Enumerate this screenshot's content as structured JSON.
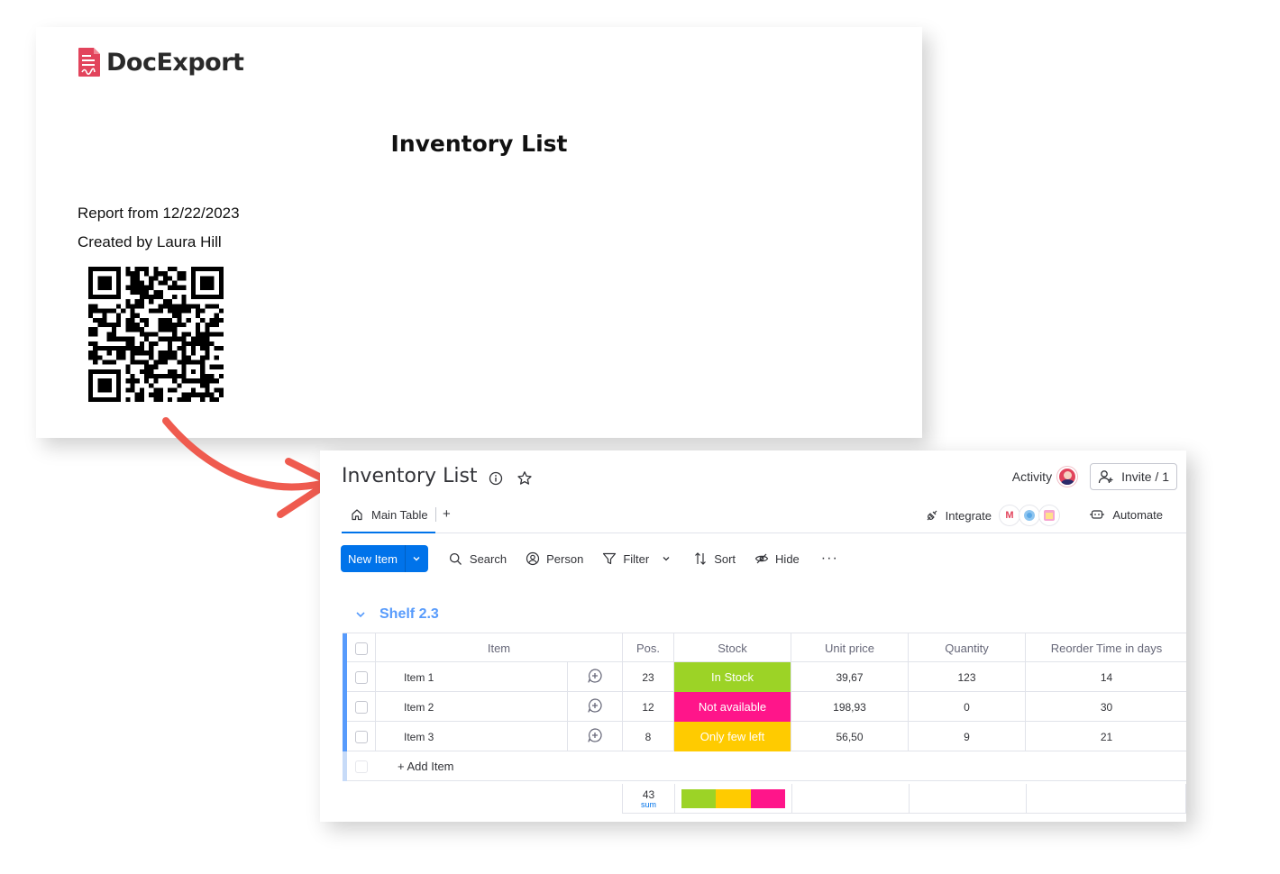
{
  "document": {
    "brand": "DocExport",
    "title": "Inventory List",
    "report_line": "Report from 12/22/2023",
    "created_line": "Created by Laura Hill"
  },
  "app": {
    "title": "Inventory List",
    "activity_label": "Activity",
    "invite_label": "Invite / 1",
    "tabs": {
      "main_label": "Main Table",
      "add_label": "+"
    },
    "integrate_label": "Integrate",
    "automate_label": "Automate",
    "toolbar": {
      "new_item": "New Item",
      "search": "Search",
      "person": "Person",
      "filter": "Filter",
      "sort": "Sort",
      "hide": "Hide",
      "more": "···"
    },
    "group": {
      "name": "Shelf 2.3"
    },
    "columns": {
      "item": "Item",
      "pos": "Pos.",
      "stock": "Stock",
      "unit_price": "Unit price",
      "quantity": "Quantity",
      "reorder": "Reorder Time in days"
    },
    "rows": [
      {
        "item": "Item 1",
        "pos": "23",
        "stock": "In Stock",
        "stock_color": "#9cd326",
        "unit_price": "39,67",
        "quantity": "123",
        "reorder": "14"
      },
      {
        "item": "Item 2",
        "pos": "12",
        "stock": "Not available",
        "stock_color": "#ff158a",
        "unit_price": "198,93",
        "quantity": "0",
        "reorder": "30"
      },
      {
        "item": "Item 3",
        "pos": "8",
        "stock": "Only few left",
        "stock_color": "#ffcb00",
        "unit_price": "56,50",
        "quantity": "9",
        "reorder": "21"
      }
    ],
    "add_item": "+ Add Item",
    "summary": {
      "pos_sum": "43",
      "pos_sum_label": "sum",
      "stock_distribution": [
        {
          "color": "#9cd326",
          "fraction": 0.333
        },
        {
          "color": "#ffcb00",
          "fraction": 0.333
        },
        {
          "color": "#ff158a",
          "fraction": 0.334
        }
      ]
    }
  },
  "colors": {
    "brand_red": "#e2445c",
    "primary_blue": "#0073ea",
    "group_blue": "#579bfc",
    "arrow": "#ef5b4f"
  }
}
